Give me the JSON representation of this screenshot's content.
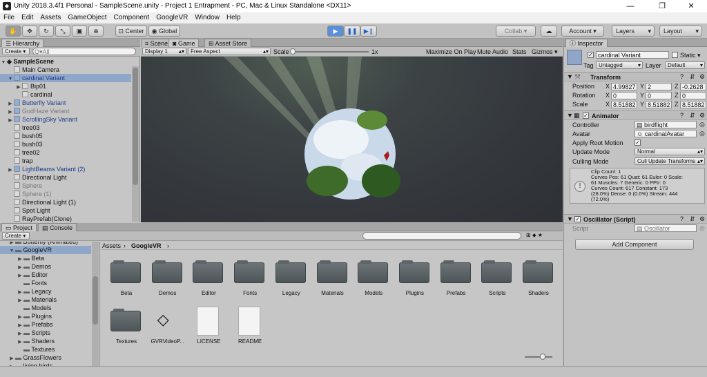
{
  "window": {
    "title": "Unity 2018.3.4f1 Personal - SampleScene.unity - Project 1 Entrapment - PC, Mac & Linux Standalone <DX11>",
    "minimize": "—",
    "maximize": "❐",
    "close": "✕"
  },
  "menu": [
    "File",
    "Edit",
    "Assets",
    "GameObject",
    "Component",
    "GoogleVR",
    "Window",
    "Help"
  ],
  "toolbar": {
    "pivot": "Center",
    "space": "Global",
    "collab": "Collab ▾",
    "account": "Account ▾",
    "layers": "Layers",
    "layout": "Layout"
  },
  "hierarchy": {
    "tab": "Hierarchy",
    "create": "Create ▾",
    "search": "Q▾All",
    "scene": "SampleScene",
    "items": [
      {
        "label": "Main Camera",
        "indent": 1,
        "arrow": "",
        "dim": false,
        "sel": false
      },
      {
        "label": "cardinal Variant",
        "indent": 1,
        "arrow": "▼",
        "dim": false,
        "sel": true
      },
      {
        "label": "Bip01",
        "indent": 2,
        "arrow": "▶",
        "dim": false,
        "sel": false
      },
      {
        "label": "cardinal",
        "indent": 2,
        "arrow": "",
        "dim": false,
        "sel": false
      },
      {
        "label": "Butterfly Variant",
        "indent": 1,
        "arrow": "▶",
        "dim": false,
        "sel": false
      },
      {
        "label": "GodHaze Variant",
        "indent": 1,
        "arrow": "▶",
        "dim": true,
        "sel": false
      },
      {
        "label": "ScrollingSky Variant",
        "indent": 1,
        "arrow": "▶",
        "dim": false,
        "sel": false
      },
      {
        "label": "tree03",
        "indent": 1,
        "arrow": "",
        "dim": false,
        "sel": false
      },
      {
        "label": "bush05",
        "indent": 1,
        "arrow": "",
        "dim": false,
        "sel": false
      },
      {
        "label": "bush03",
        "indent": 1,
        "arrow": "",
        "dim": false,
        "sel": false
      },
      {
        "label": "tree02",
        "indent": 1,
        "arrow": "",
        "dim": false,
        "sel": false
      },
      {
        "label": "trap",
        "indent": 1,
        "arrow": "",
        "dim": false,
        "sel": false
      },
      {
        "label": "LightBeams Variant (2)",
        "indent": 1,
        "arrow": "▶",
        "dim": false,
        "sel": false
      },
      {
        "label": "Directional Light",
        "indent": 1,
        "arrow": "",
        "dim": false,
        "sel": false
      },
      {
        "label": "Sphere",
        "indent": 1,
        "arrow": "",
        "dim": true,
        "sel": false
      },
      {
        "label": "Sphere (1)",
        "indent": 1,
        "arrow": "",
        "dim": true,
        "sel": false
      },
      {
        "label": "Directional Light (1)",
        "indent": 1,
        "arrow": "",
        "dim": false,
        "sel": false
      },
      {
        "label": "Spot Light",
        "indent": 1,
        "arrow": "",
        "dim": false,
        "sel": false
      },
      {
        "label": "RayPrefab(Clone)",
        "indent": 1,
        "arrow": "",
        "dim": false,
        "sel": false
      }
    ]
  },
  "view": {
    "tabs": [
      "Scene",
      "Game",
      "Asset Store"
    ],
    "display": "Display 1",
    "aspect": "Free Aspect",
    "scale_label": "Scale",
    "scale_value": "1x",
    "buttons": [
      "Maximize On Play",
      "Mute Audio",
      "Stats",
      "Gizmos ▾"
    ]
  },
  "project": {
    "tabs": [
      "Project",
      "Console"
    ],
    "create": "Create ▾",
    "tree": [
      {
        "label": "Butterfly (Animated)",
        "indent": 1,
        "arrow": "▶"
      },
      {
        "label": "GoogleVR",
        "indent": 1,
        "arrow": "▼"
      },
      {
        "label": "Beta",
        "indent": 2,
        "arrow": "▶"
      },
      {
        "label": "Demos",
        "indent": 2,
        "arrow": "▶"
      },
      {
        "label": "Editor",
        "indent": 2,
        "arrow": "▶"
      },
      {
        "label": "Fonts",
        "indent": 2,
        "arrow": ""
      },
      {
        "label": "Legacy",
        "indent": 2,
        "arrow": "▶"
      },
      {
        "label": "Materials",
        "indent": 2,
        "arrow": "▶"
      },
      {
        "label": "Models",
        "indent": 2,
        "arrow": ""
      },
      {
        "label": "Plugins",
        "indent": 2,
        "arrow": "▶"
      },
      {
        "label": "Prefabs",
        "indent": 2,
        "arrow": "▶"
      },
      {
        "label": "Scripts",
        "indent": 2,
        "arrow": "▶"
      },
      {
        "label": "Shaders",
        "indent": 2,
        "arrow": "▶"
      },
      {
        "label": "Textures",
        "indent": 2,
        "arrow": ""
      },
      {
        "label": "GrassFlowers",
        "indent": 1,
        "arrow": "▶"
      },
      {
        "label": "living birds",
        "indent": 1,
        "arrow": "▶"
      }
    ],
    "breadcrumb": [
      "Assets",
      "GoogleVR"
    ],
    "assets": [
      {
        "label": "Beta",
        "kind": "folder"
      },
      {
        "label": "Demos",
        "kind": "folder"
      },
      {
        "label": "Editor",
        "kind": "folder"
      },
      {
        "label": "Fonts",
        "kind": "folder"
      },
      {
        "label": "Legacy",
        "kind": "folder"
      },
      {
        "label": "Materials",
        "kind": "folder"
      },
      {
        "label": "Models",
        "kind": "folder"
      },
      {
        "label": "Plugins",
        "kind": "folder"
      },
      {
        "label": "Prefabs",
        "kind": "folder"
      },
      {
        "label": "Scripts",
        "kind": "folder"
      },
      {
        "label": "Shaders",
        "kind": "folder"
      },
      {
        "label": "Textures",
        "kind": "folder"
      },
      {
        "label": "GVRVideoP...",
        "kind": "unity"
      },
      {
        "label": "LICENSE",
        "kind": "doc"
      },
      {
        "label": "README",
        "kind": "doc"
      }
    ]
  },
  "inspector": {
    "tab": "Inspector",
    "name": "cardinal Variant",
    "static": "Static ▾",
    "tag_label": "Tag",
    "tag": "Untagged",
    "layer_label": "Layer",
    "layer": "Default",
    "transform": {
      "title": "Transform",
      "rows": [
        {
          "label": "Position",
          "x": "4.99827",
          "y": "2",
          "z": "-0.2628"
        },
        {
          "label": "Rotation",
          "x": "0",
          "y": "0",
          "z": "0"
        },
        {
          "label": "Scale",
          "x": "8.51882",
          "y": "8.51882",
          "z": "8.51882"
        }
      ]
    },
    "animator": {
      "title": "Animator",
      "controller_label": "Controller",
      "controller": "birdflight",
      "avatar_label": "Avatar",
      "avatar": "cardinalAvatar",
      "rootmotion_label": "Apply Root Motion",
      "update_label": "Update Mode",
      "update": "Normal",
      "culling_label": "Culling Mode",
      "culling": "Cull Update Transforms",
      "info": [
        "Clip Count: 1",
        "Curves Pos: 61 Quat: 61 Euler: 0 Scale:",
        "61 Muscles: 7 Generic: 0 PPtr: 0",
        "Curves Count: 617 Constant: 173",
        "(28.0%) Dense: 0 (0.0%) Stream: 444",
        "(72.0%)"
      ]
    },
    "oscillator": {
      "title": "Oscillator (Script)",
      "script_label": "Script",
      "script": "Oscillator"
    },
    "add_component": "Add Component"
  }
}
